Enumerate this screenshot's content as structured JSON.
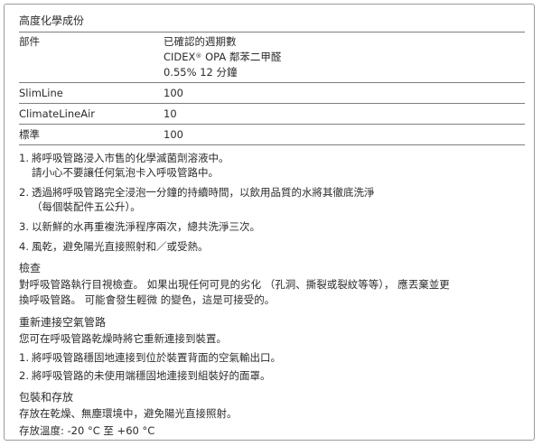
{
  "doc": {
    "title": "高度化學成份",
    "table": {
      "header": {
        "col1": "部件",
        "col2_lines": [
          "已確認的週期數",
          "CIDEX",
          "OPA 鄰苯二甲醛",
          "0.55% 12 分鐘"
        ],
        "reg_mark": "®"
      },
      "rows": [
        {
          "part": "SlimLine",
          "cycles": "100"
        },
        {
          "part": "ClimateLineAir",
          "cycles": "10"
        },
        {
          "part": "標準",
          "cycles": "100"
        }
      ]
    },
    "steps": [
      {
        "num": "1.",
        "lines": [
          "將呼吸管路浸入市售的化學滅菌劑溶液中。",
          "請小心不要讓任何氣泡卡入呼吸管路中。"
        ]
      },
      {
        "num": "2.",
        "lines": [
          "透過將呼吸管路完全浸泡一分鐘的持續時間，以飲用品質的水將其徹底洗淨",
          "（每個裝配件五公升）。"
        ]
      },
      {
        "num": "3.",
        "lines": [
          "以新鮮的水再重複洗淨程序兩次，總共洗淨三次。"
        ]
      },
      {
        "num": "4.",
        "lines": [
          "風乾，避免陽光直接照射和／或受熱。"
        ]
      }
    ],
    "inspection": {
      "heading": "檢查",
      "lines": [
        "對呼吸管路執行目視檢查。 如果出現任何可見的劣化 （孔洞、撕裂或裂紋等等）， 應丟棄並更",
        "換呼吸管路。 可能會發生輕微 的變色，這是可接受的。"
      ]
    },
    "reconnect": {
      "heading": "重新連接空氣管路",
      "intro": "您可在呼吸管路乾燥時將它重新連接到裝置。",
      "steps": [
        {
          "num": "1.",
          "text": "將呼吸管路穩固地連接到位於裝置背面的空氣輸出口。"
        },
        {
          "num": "2.",
          "text": "將呼吸管路的未使用端穩固地連接到組裝好的面罩。"
        }
      ]
    },
    "storage": {
      "heading": "包裝和存放",
      "line1": "存放在乾燥、無塵環境中，避免陽光直接照射。",
      "line2": "存放溫度: -20 °C 至 +60 °C"
    }
  }
}
